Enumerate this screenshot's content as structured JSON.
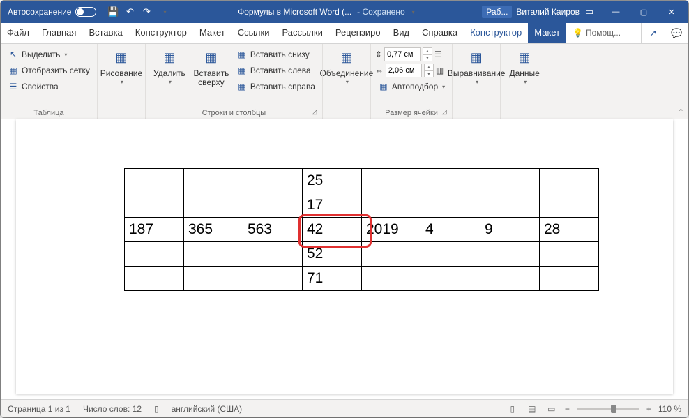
{
  "titlebar": {
    "autosave": "Автосохранение",
    "doc_title": "Формулы в Microsoft Word (... ",
    "saved": "- Сохранено",
    "account_short": "Раб...",
    "user": "Виталий Каиров"
  },
  "tabs": {
    "file": "Файл",
    "home": "Главная",
    "insert": "Вставка",
    "design": "Конструктор",
    "layout": "Макет",
    "references": "Ссылки",
    "mailings": "Рассылки",
    "review": "Рецензиро",
    "view": "Вид",
    "help": "Справка",
    "ctx_design": "Конструктор",
    "ctx_layout": "Макет",
    "tell": "Помощ..."
  },
  "ribbon": {
    "select": "Выделить",
    "gridlines": "Отобразить сетку",
    "properties": "Свойства",
    "group_table": "Таблица",
    "draw": "Рисование",
    "delete": "Удалить",
    "insert_above": "Вставить сверху",
    "insert_below": "Вставить снизу",
    "insert_left": "Вставить слева",
    "insert_right": "Вставить справа",
    "group_rows": "Строки и столбцы",
    "merge": "Объединение",
    "height": "0,77 см",
    "width": "2,06 см",
    "autofit": "Автоподбор",
    "group_cell": "Размер ячейки",
    "align": "Выравнивание",
    "data": "Данные"
  },
  "table": {
    "r1": [
      "",
      "",
      "",
      "25",
      "",
      "",
      "",
      ""
    ],
    "r2": [
      "",
      "",
      "",
      "17",
      "",
      "",
      "",
      ""
    ],
    "r3": [
      "187",
      "365",
      "563",
      "42",
      "2019",
      "4",
      "9",
      "28"
    ],
    "r4": [
      "",
      "",
      "",
      "52",
      "",
      "",
      "",
      ""
    ],
    "r5": [
      "",
      "",
      "",
      "71",
      "",
      "",
      "",
      ""
    ]
  },
  "status": {
    "page": "Страница 1 из 1",
    "words": "Число слов: 12",
    "lang": "английский (США)",
    "zoom": "110 %"
  }
}
